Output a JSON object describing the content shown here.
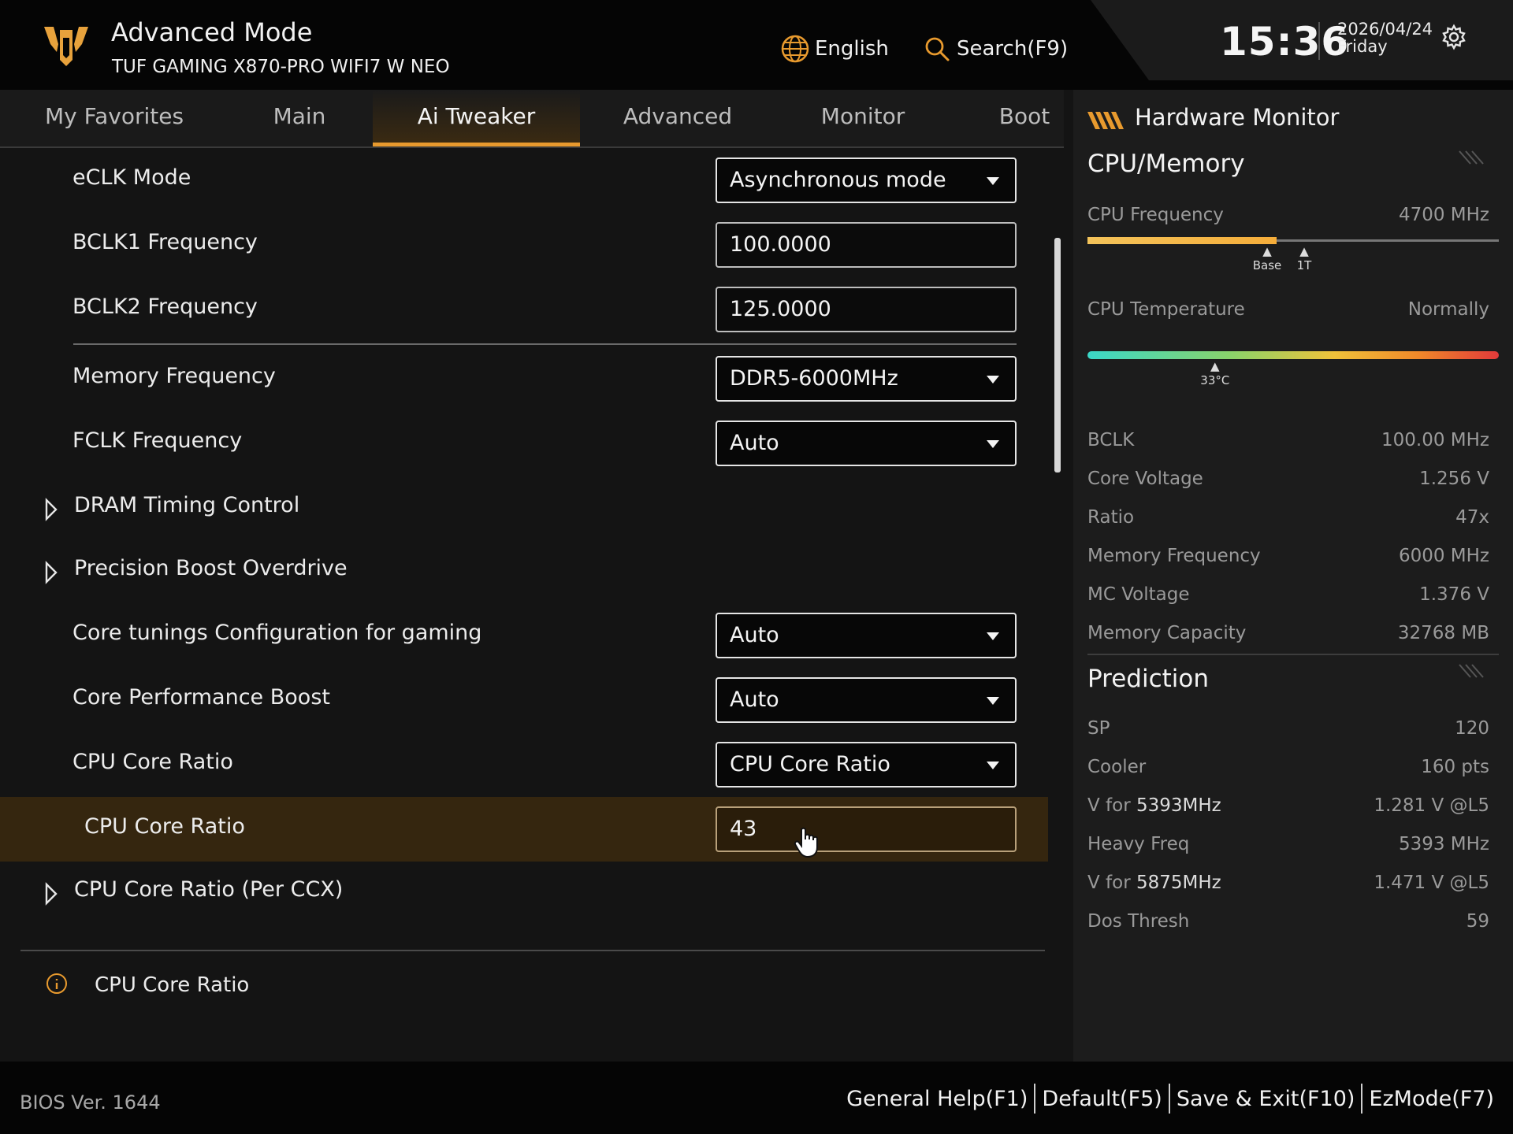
{
  "header": {
    "mode_title": "Advanced Mode",
    "board_name": "TUF GAMING X870-PRO WIFI7 W NEO",
    "language": "English",
    "search": "Search(F9)",
    "time": "15:36",
    "date": "2026/04/24",
    "day": "Friday",
    "icons": {
      "logo": "tuf-logo",
      "language": "globe-icon",
      "search": "search-icon",
      "settings": "gear-icon"
    },
    "accent": "#e89a2e"
  },
  "tabs": [
    {
      "label": "My Favorites"
    },
    {
      "label": "Main"
    },
    {
      "label": "Ai Tweaker",
      "active": true
    },
    {
      "label": "Advanced"
    },
    {
      "label": "Monitor"
    },
    {
      "label": "Boot"
    }
  ],
  "settings": {
    "eclk_mode": {
      "label": "eCLK Mode",
      "value": "Asynchronous mode"
    },
    "bclk1": {
      "label": "BCLK1 Frequency",
      "value": "100.0000"
    },
    "bclk2": {
      "label": "BCLK2 Frequency",
      "value": "125.0000"
    },
    "mem_freq": {
      "label": "Memory Frequency",
      "value": "DDR5-6000MHz"
    },
    "fclk": {
      "label": "FCLK Frequency",
      "value": "Auto"
    },
    "dram_timing": {
      "label": "DRAM Timing Control"
    },
    "pbo": {
      "label": "Precision Boost Overdrive"
    },
    "core_tunings": {
      "label": "Core tunings Configuration for gaming",
      "value": "Auto"
    },
    "core_perf_boost": {
      "label": "Core Performance Boost",
      "value": "Auto"
    },
    "cpu_core_ratio_mode": {
      "label": "CPU Core Ratio",
      "value": "CPU Core Ratio"
    },
    "cpu_core_ratio": {
      "label": "CPU Core Ratio",
      "value": "43"
    },
    "cpu_core_ratio_ccx": {
      "label": "CPU Core Ratio (Per CCX)"
    }
  },
  "help": {
    "text": "CPU Core Ratio",
    "icon": "info-icon"
  },
  "hardware_monitor": {
    "title": "Hardware Monitor",
    "cpu_memory_title": "CPU/Memory",
    "cpu_frequency": {
      "label": "CPU Frequency",
      "value": "4700 MHz",
      "fill_fraction": 0.46,
      "base_label": "Base",
      "one_t_label": "1T"
    },
    "cpu_temperature": {
      "label": "CPU Temperature",
      "value": "Normally",
      "reading": "33°C",
      "marker_fraction": 0.31
    },
    "rows": [
      {
        "label": "BCLK",
        "value": "100.00 MHz"
      },
      {
        "label": "Core Voltage",
        "value": "1.256 V"
      },
      {
        "label": "Ratio",
        "value": "47x"
      },
      {
        "label": "Memory Frequency",
        "value": "6000 MHz"
      },
      {
        "label": "MC Voltage",
        "value": "1.376 V"
      },
      {
        "label": "Memory Capacity",
        "value": "32768 MB"
      }
    ],
    "prediction_title": "Prediction",
    "prediction": {
      "sp": {
        "label": "SP",
        "value": "120"
      },
      "cooler": {
        "label": "Cooler",
        "value": "160 pts"
      },
      "v_for_1": {
        "label_prefix": "V for ",
        "label_strong": "5393MHz",
        "value": "1.281 V @L5"
      },
      "heavy_freq": {
        "label": "Heavy Freq",
        "value": "5393 MHz"
      },
      "v_for_2": {
        "label_prefix": "V for ",
        "label_strong": "5875MHz",
        "value": "1.471 V @L5"
      },
      "dos_thresh": {
        "label": "Dos Thresh",
        "value": "59"
      }
    }
  },
  "footer": {
    "bios_version": "BIOS Ver. 1644",
    "general_help": "General Help(F1)",
    "default": "Default(F5)",
    "save_exit": "Save & Exit(F10)",
    "ezmode": "EzMode(F7)"
  }
}
